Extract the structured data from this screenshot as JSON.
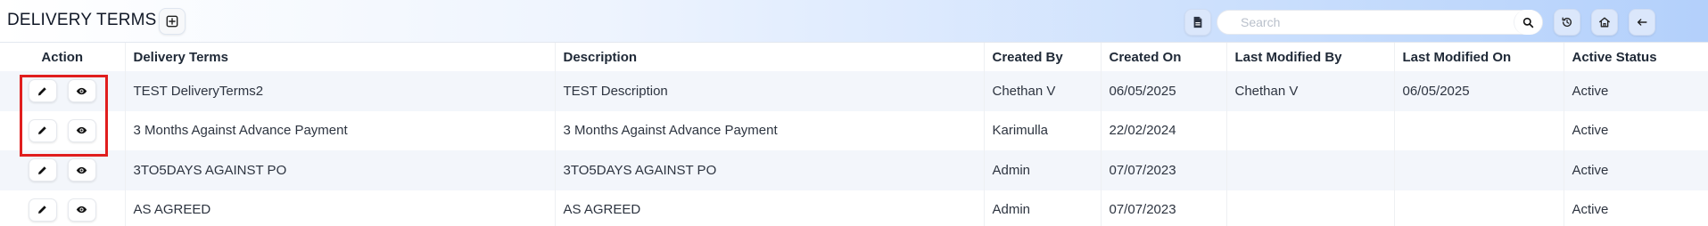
{
  "header": {
    "title": "DELIVERY TERMS",
    "search_placeholder": "Search",
    "search_value": "",
    "add_icon": "plus-square-icon",
    "pdf_icon": "pdf-file-icon",
    "history_icon": "history-icon",
    "home_icon": "home-icon",
    "back_icon": "arrow-left-icon"
  },
  "table": {
    "columns": [
      "Action",
      "Delivery Terms",
      "Description",
      "Created By",
      "Created On",
      "Last Modified By",
      "Last Modified On",
      "Active Status"
    ],
    "rows": [
      {
        "delivery_terms": "TEST DeliveryTerms2",
        "description": "TEST Description",
        "created_by": "Chethan V",
        "created_on": "06/05/2025",
        "last_modified_by": "Chethan V",
        "last_modified_on": "06/05/2025",
        "active_status": "Active"
      },
      {
        "delivery_terms": "3 Months Against Advance Payment",
        "description": "3 Months Against Advance Payment",
        "created_by": "Karimulla",
        "created_on": "22/02/2024",
        "last_modified_by": "",
        "last_modified_on": "",
        "active_status": "Active"
      },
      {
        "delivery_terms": "3TO5DAYS AGAINST PO",
        "description": "3TO5DAYS AGAINST PO",
        "created_by": "Admin",
        "created_on": "07/07/2023",
        "last_modified_by": "",
        "last_modified_on": "",
        "active_status": "Active"
      },
      {
        "delivery_terms": "AS AGREED",
        "description": "AS AGREED",
        "created_by": "Admin",
        "created_on": "07/07/2023",
        "last_modified_by": "",
        "last_modified_on": "",
        "active_status": "Active"
      }
    ],
    "row_actions": [
      "pencil-icon",
      "eye-icon"
    ]
  },
  "colors": {
    "highlight": "#e01e1e",
    "header_gradient_end": "#b3d0fb",
    "row_stripe": "#f3f6fb"
  }
}
